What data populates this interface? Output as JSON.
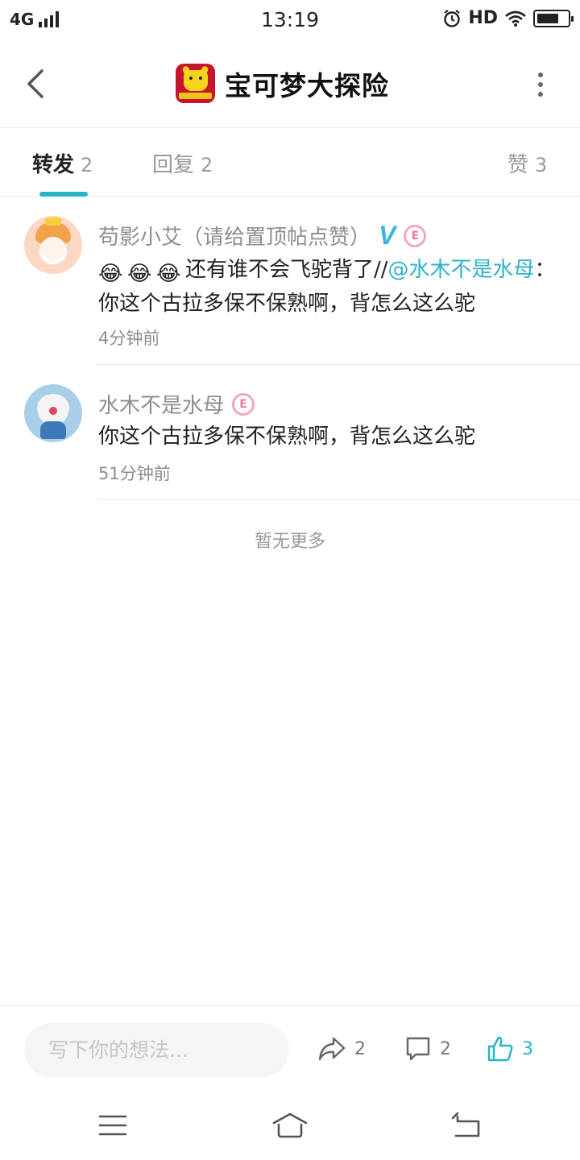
{
  "status_bar": {
    "network": "4G",
    "time": "13:19",
    "hd": "HD"
  },
  "header": {
    "title": "宝可梦大探险"
  },
  "tabs": [
    {
      "label": "转发",
      "count": "2",
      "active": true
    },
    {
      "label": "回复",
      "count": "2",
      "active": false
    },
    {
      "label": "赞",
      "count": "3",
      "active": false
    }
  ],
  "comments": [
    {
      "name": "苟影小艾（请给置顶帖点赞）",
      "verified_badge": "V",
      "level_badge": "E",
      "emojis": [
        "😂",
        "😂",
        "😂"
      ],
      "text_before_mention": "还有谁不会飞驼背了//",
      "mention": "@水木不是水母",
      "text_after_mention": "：你这个古拉多保不保熟啊，背怎么这么驼",
      "time": "4分钟前"
    },
    {
      "name": "水木不是水母",
      "level_badge": "E",
      "text": "你这个古拉多保不保熟啊，背怎么这么驼",
      "time": "51分钟前"
    }
  ],
  "no_more_text": "暂无更多",
  "bottom_bar": {
    "input_placeholder": "写下你的想法...",
    "share_count": "2",
    "comment_count": "2",
    "like_count": "3",
    "accent_color": "#25b6c3"
  }
}
